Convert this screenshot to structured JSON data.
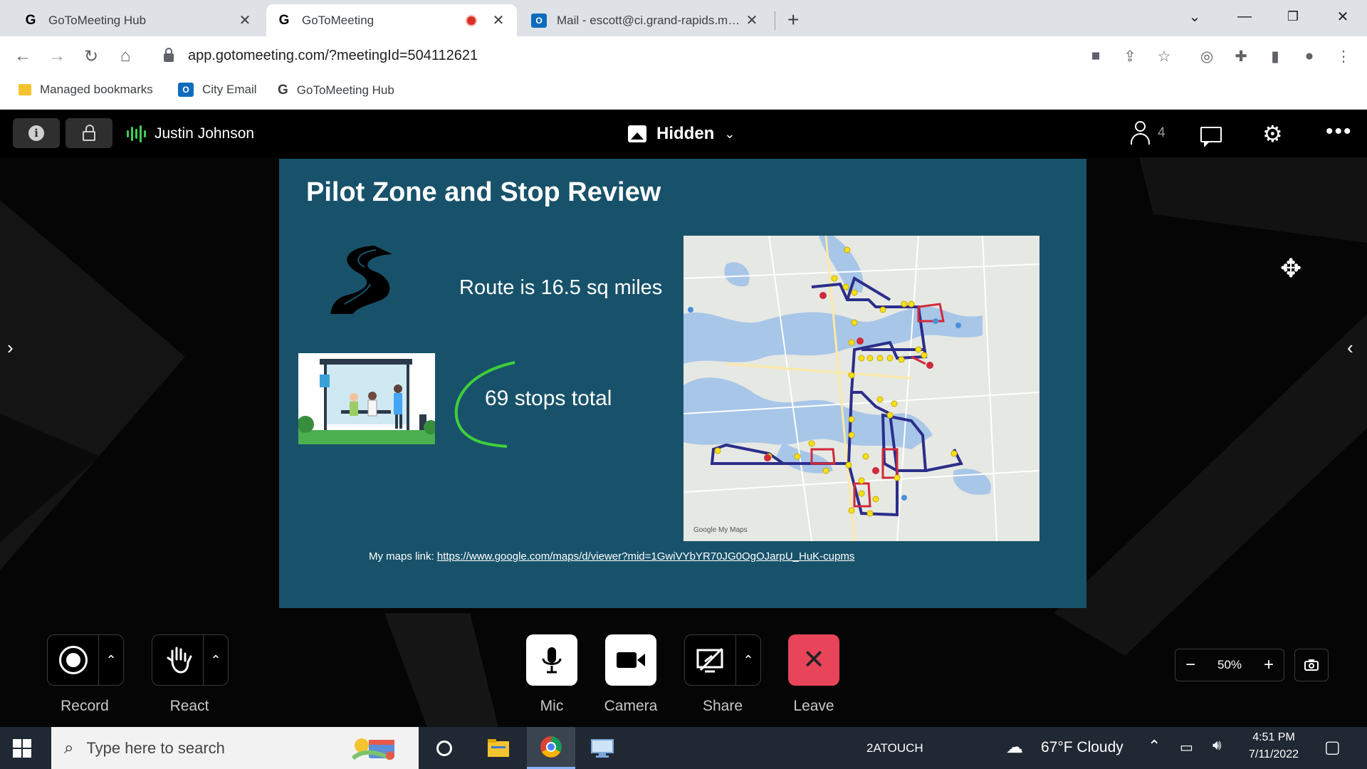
{
  "browser": {
    "tabs": [
      {
        "title": "GoToMeeting Hub",
        "favicon": "G"
      },
      {
        "title": "GoToMeeting",
        "favicon": "G",
        "active": true,
        "recording": true
      },
      {
        "title": "Mail - escott@ci.grand-rapids.mn.us",
        "favicon": "outlook"
      }
    ],
    "new_tab": "+",
    "url": "app.gotomeeting.com/?meetingId=504112621",
    "bookmarks": [
      {
        "label": "Managed bookmarks"
      },
      {
        "label": "City Email"
      },
      {
        "label": "GoToMeeting Hub"
      }
    ]
  },
  "meeting": {
    "speaker": "Justin Johnson",
    "view_mode": "Hidden",
    "attendee_count": "4",
    "slide": {
      "title": "Pilot Zone and Stop Review",
      "route_text": "Route is 16.5 sq miles",
      "stops_text": "69 stops total",
      "link_prefix": "My maps link: ",
      "link_url": "https://www.google.com/maps/d/viewer?mid=1GwiVYbYR70JG0OgOJarpU_HuK-cupms",
      "map_credit": "Google My Maps"
    },
    "controls": {
      "record": "Record",
      "react": "React",
      "mic": "Mic",
      "camera": "Camera",
      "share": "Share",
      "leave": "Leave"
    },
    "zoom": "50%",
    "colors": {
      "leave": "#e8455a",
      "speaking": "#3fcf5a",
      "slide_bg": "#18526a"
    }
  },
  "taskbar": {
    "search_placeholder": "Type here to search",
    "app_label": "2ATOUCH",
    "weather": "67°F  Cloudy",
    "time": "4:51 PM",
    "date": "7/11/2022"
  }
}
